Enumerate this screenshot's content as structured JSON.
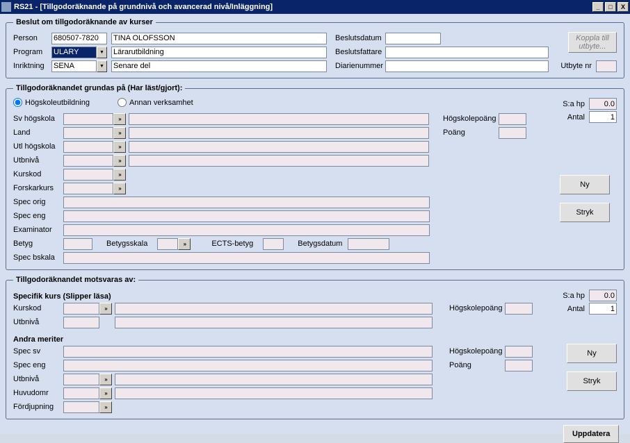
{
  "titlebar": {
    "app": "RS21",
    "title": "[Tillgodoräknande på grundnivå och avancerad nivå/Inläggning]"
  },
  "window_controls": {
    "min": "_",
    "max": "□",
    "close": "X"
  },
  "section1": {
    "legend": "Beslut om tillgodoräknande av kurser",
    "person_label": "Person",
    "person_value": "680507-7820",
    "person_name": "TINA OLOFSSON",
    "program_label": "Program",
    "program_value": "ULARY",
    "program_name": "Lärarutbildning",
    "inriktning_label": "Inriktning",
    "inriktning_value": "SENA",
    "inriktning_name": "Senare del",
    "beslutsdatum_label": "Beslutsdatum",
    "beslutsfattare_label": "Beslutsfattare",
    "diarienummer_label": "Diarienummer",
    "utbyte_label": "Utbyte nr",
    "koppla_btn": "Koppla till utbyte..."
  },
  "section2": {
    "legend": "Tillgodoräknandet grundas på (Har läst/gjort):",
    "radio_hogskole": "Högskoleutbildning",
    "radio_annan": "Annan verksamhet",
    "sa_hp_label": "S:a hp",
    "sa_hp_value": "0.0",
    "antal_label": "Antal",
    "antal_value": "1",
    "sv_hogskola": "Sv högskola",
    "land": "Land",
    "utl_hogskola": "Utl högskola",
    "utbniva": "Utbnivå",
    "kurskod": "Kurskod",
    "forskarkurs": "Forskarkurs",
    "spec_orig": "Spec orig",
    "spec_eng": "Spec eng",
    "examinator": "Examinator",
    "betyg": "Betyg",
    "betygsskala": "Betygsskala",
    "ects_betyg": "ECTS-betyg",
    "betygsdatum": "Betygsdatum",
    "spec_bskala": "Spec bskala",
    "hogskolepoang": "Högskolepoäng",
    "poang": "Poäng",
    "ny_btn": "Ny",
    "stryk_btn": "Stryk"
  },
  "section3": {
    "legend": "Tillgodoräknandet motsvaras av:",
    "sa_hp_label": "S:a hp",
    "sa_hp_value": "0.0",
    "antal_label": "Antal",
    "antal_value": "1",
    "specifik_heading": "Specifik kurs (Slipper läsa)",
    "kurskod": "Kurskod",
    "utbniva": "Utbnivå",
    "hogskolepoang": "Högskolepoäng",
    "andra_heading": "Andra meriter",
    "spec_sv": "Spec sv",
    "spec_eng": "Spec eng",
    "utbniva2": "Utbnivå",
    "huvudomr": "Huvudomr",
    "fordjupning": "Fördjupning",
    "poang": "Poäng",
    "ny_btn": "Ny",
    "stryk_btn": "Stryk"
  },
  "footer": {
    "uppdatera": "Uppdatera"
  }
}
